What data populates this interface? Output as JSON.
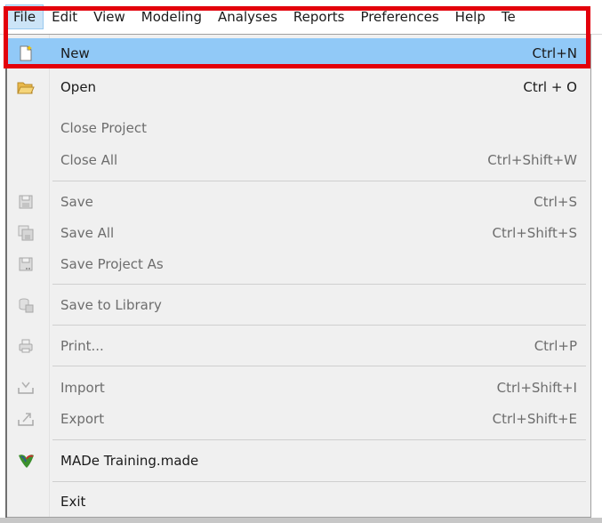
{
  "menubar": {
    "items": [
      "File",
      "Edit",
      "View",
      "Modeling",
      "Analyses",
      "Reports",
      "Preferences",
      "Help",
      "Te"
    ]
  },
  "file_menu": {
    "new": {
      "label": "New",
      "shortcut": "Ctrl+N",
      "icon": "new-file-icon"
    },
    "open": {
      "label": "Open",
      "shortcut": "Ctrl + O",
      "icon": "open-folder-icon"
    },
    "close_project": {
      "label": "Close Project",
      "shortcut": ""
    },
    "close_all": {
      "label": "Close All",
      "shortcut": "Ctrl+Shift+W"
    },
    "save": {
      "label": "Save",
      "shortcut": "Ctrl+S",
      "icon": "save-icon"
    },
    "save_all": {
      "label": "Save All",
      "shortcut": "Ctrl+Shift+S",
      "icon": "save-all-icon"
    },
    "save_project_as": {
      "label": "Save Project As",
      "shortcut": "",
      "icon": "save-as-icon"
    },
    "save_to_library": {
      "label": "Save to Library",
      "shortcut": "",
      "icon": "library-icon"
    },
    "print": {
      "label": "Print...",
      "shortcut": "Ctrl+P",
      "icon": "printer-icon"
    },
    "import": {
      "label": "Import",
      "shortcut": "Ctrl+Shift+I",
      "icon": "import-icon"
    },
    "export": {
      "label": "Export",
      "shortcut": "Ctrl+Shift+E",
      "icon": "export-icon"
    },
    "recent": {
      "label": "MADe Training.made",
      "icon": "made-project-icon"
    },
    "exit": {
      "label": "Exit"
    }
  },
  "colors": {
    "highlight_bg": "#91c9f7",
    "annotation_border": "#e3000b",
    "menu_bg": "#f0f0f0"
  }
}
